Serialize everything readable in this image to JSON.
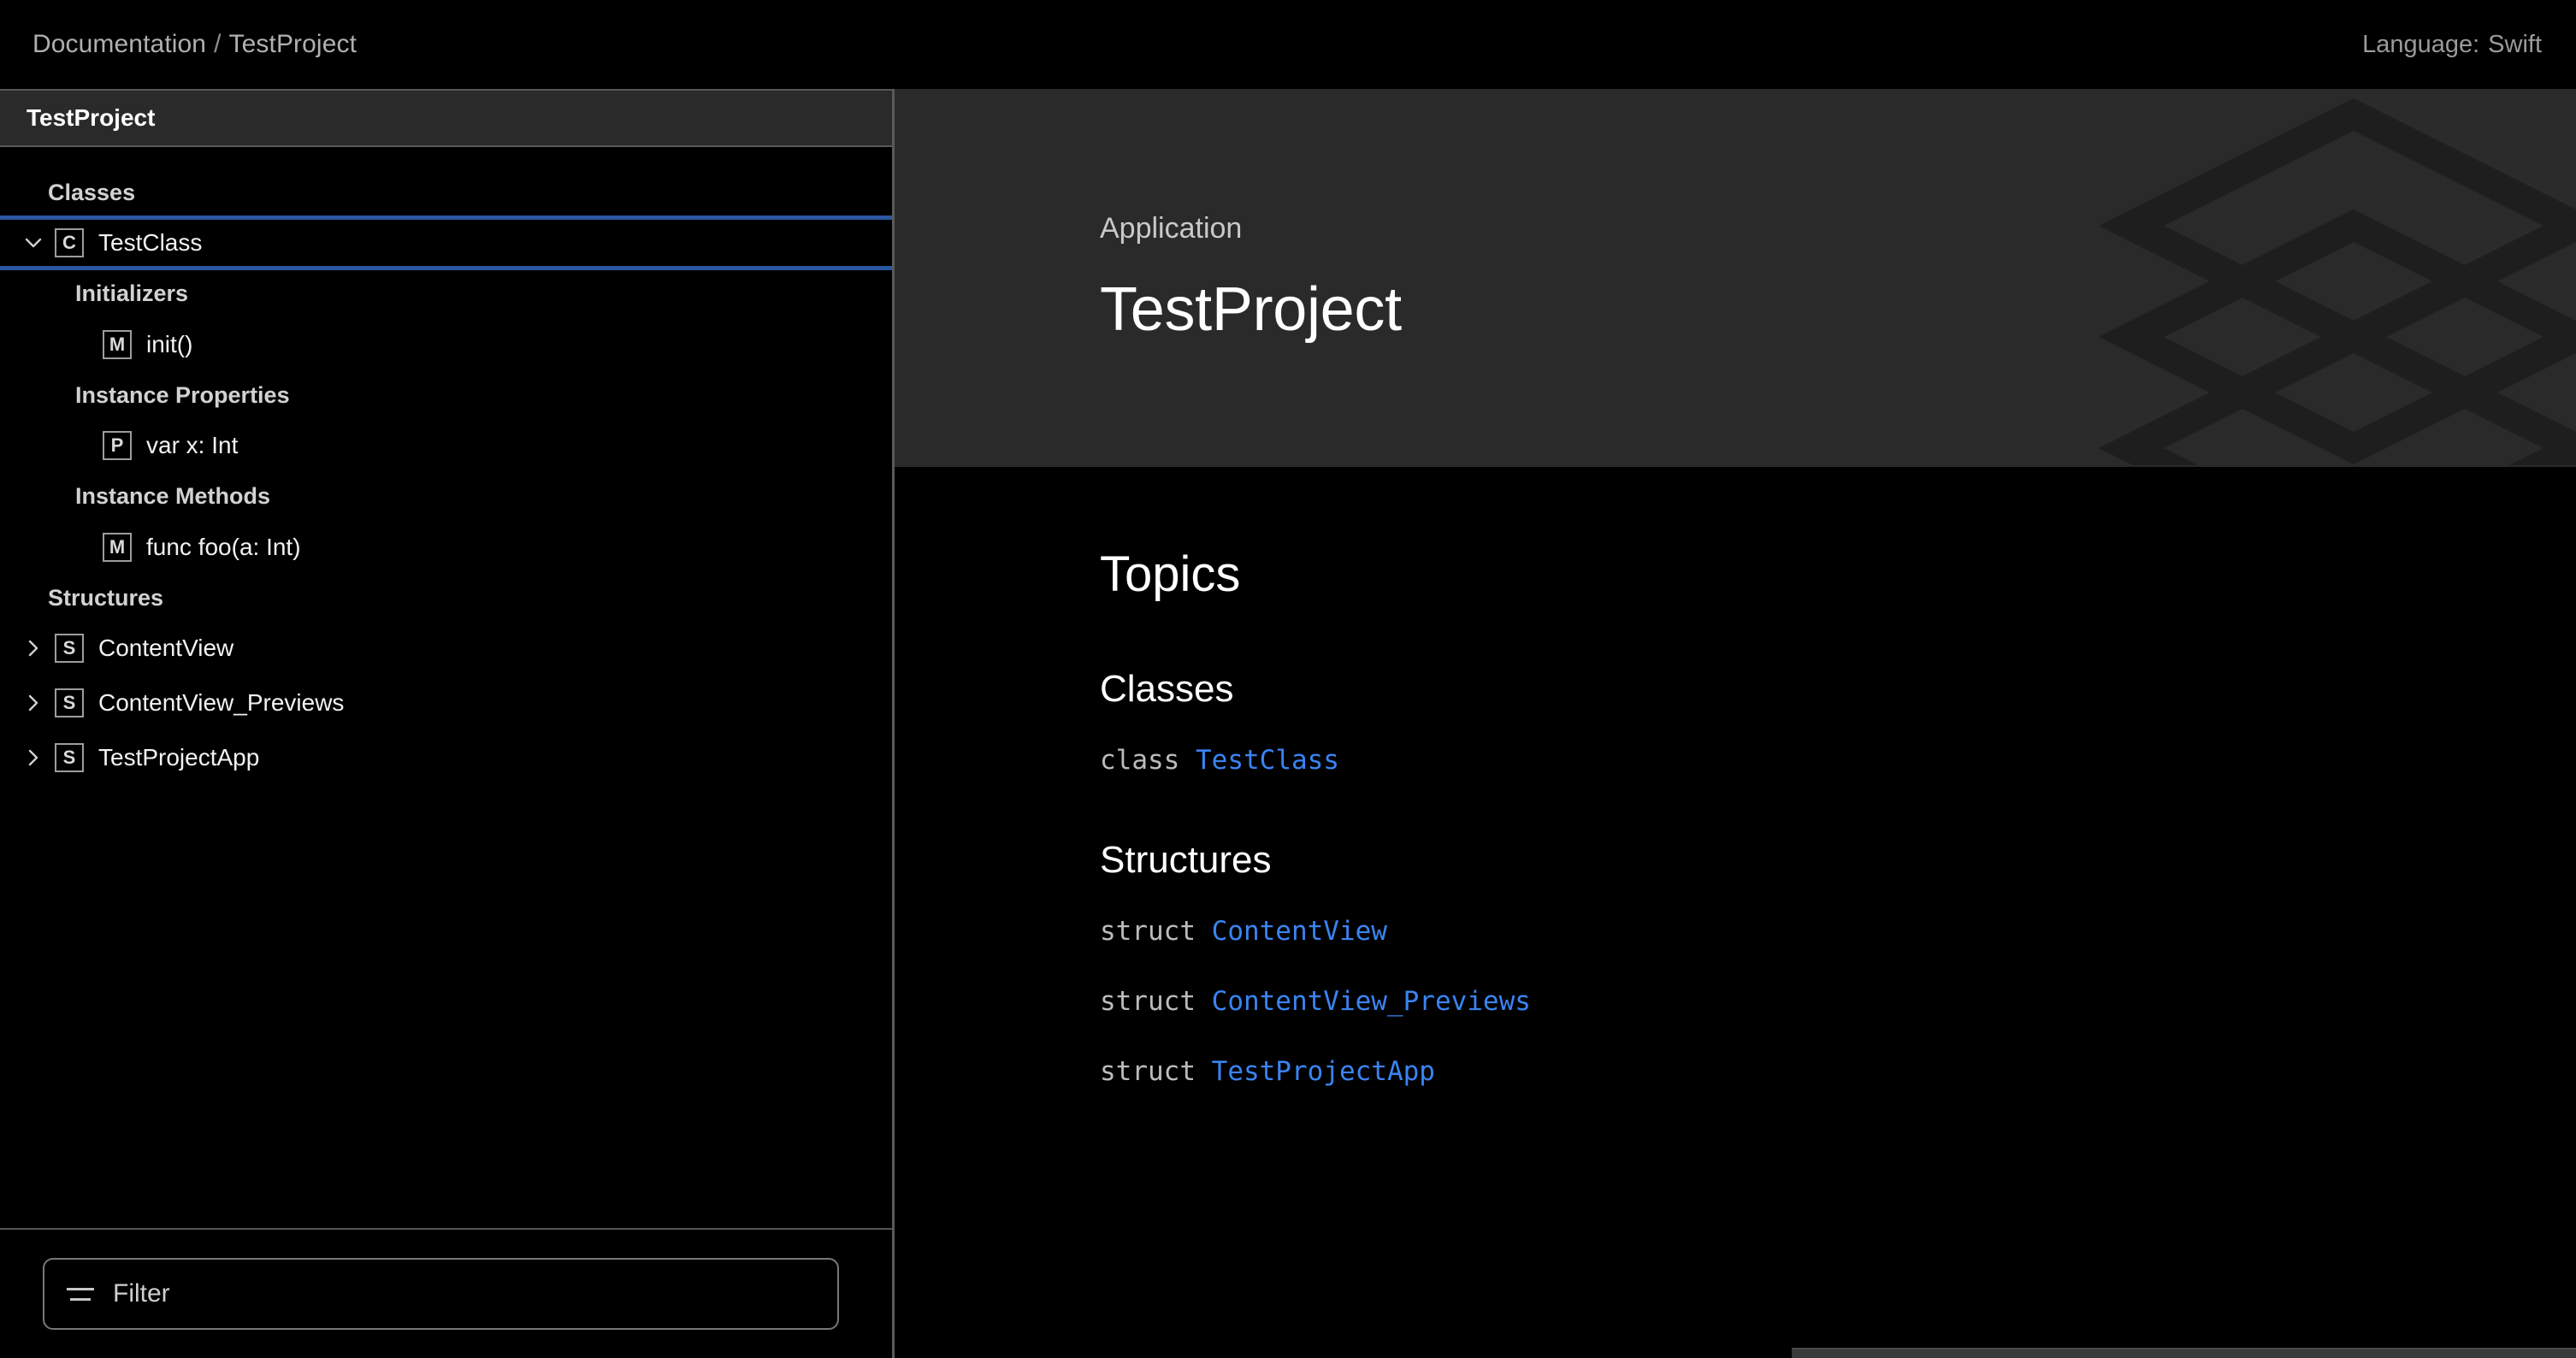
{
  "topbar": {
    "breadcrumb": {
      "root": "Documentation",
      "separator": "/",
      "current": "TestProject"
    },
    "language": {
      "label": "Language:",
      "value": "Swift"
    }
  },
  "sidebar": {
    "title": "TestProject",
    "nav": [
      {
        "kind": "group",
        "label": "Classes",
        "level": 1
      },
      {
        "kind": "item",
        "label": "TestClass",
        "badge": "C",
        "chevron": "chevron-down",
        "selected": true,
        "indent": 0
      },
      {
        "kind": "group",
        "label": "Initializers",
        "level": 2
      },
      {
        "kind": "item",
        "label": "init()",
        "badge": "M",
        "chevron": "none",
        "selected": false,
        "indent": 1
      },
      {
        "kind": "group",
        "label": "Instance Properties",
        "level": 2
      },
      {
        "kind": "item",
        "label": "var x: Int",
        "badge": "P",
        "chevron": "none",
        "selected": false,
        "indent": 1
      },
      {
        "kind": "group",
        "label": "Instance Methods",
        "level": 2
      },
      {
        "kind": "item",
        "label": "func foo(a: Int)",
        "badge": "M",
        "chevron": "none",
        "selected": false,
        "indent": 1
      },
      {
        "kind": "group",
        "label": "Structures",
        "level": 1
      },
      {
        "kind": "item",
        "label": "ContentView",
        "badge": "S",
        "chevron": "chevron-right",
        "selected": false,
        "indent": 0
      },
      {
        "kind": "item",
        "label": "ContentView_Previews",
        "badge": "S",
        "chevron": "chevron-right",
        "selected": false,
        "indent": 0
      },
      {
        "kind": "item",
        "label": "TestProjectApp",
        "badge": "S",
        "chevron": "chevron-right",
        "selected": false,
        "indent": 0
      }
    ],
    "filter": {
      "placeholder": "Filter",
      "value": "",
      "icon": "filter-lines-icon"
    }
  },
  "hero": {
    "eyebrow": "Application",
    "title": "TestProject",
    "artwork": "layers-stack-icon"
  },
  "main": {
    "topics_heading": "Topics",
    "sections": [
      {
        "heading": "Classes",
        "declarations": [
          {
            "keyword": "class",
            "name": "TestClass"
          }
        ]
      },
      {
        "heading": "Structures",
        "declarations": [
          {
            "keyword": "struct",
            "name": "ContentView"
          },
          {
            "keyword": "struct",
            "name": "ContentView_Previews"
          },
          {
            "keyword": "struct",
            "name": "TestProjectApp"
          }
        ]
      }
    ]
  },
  "colors": {
    "page_background": "#000000",
    "hero_background": "#2a2a2a",
    "sidebar_header_background": "#2a2a2a",
    "link_blue": "#3a84f2",
    "selection_ring_blue": "#2b56a0",
    "divider_gray": "#5a5a5a",
    "artwork_gray": "#1e1e1e"
  }
}
